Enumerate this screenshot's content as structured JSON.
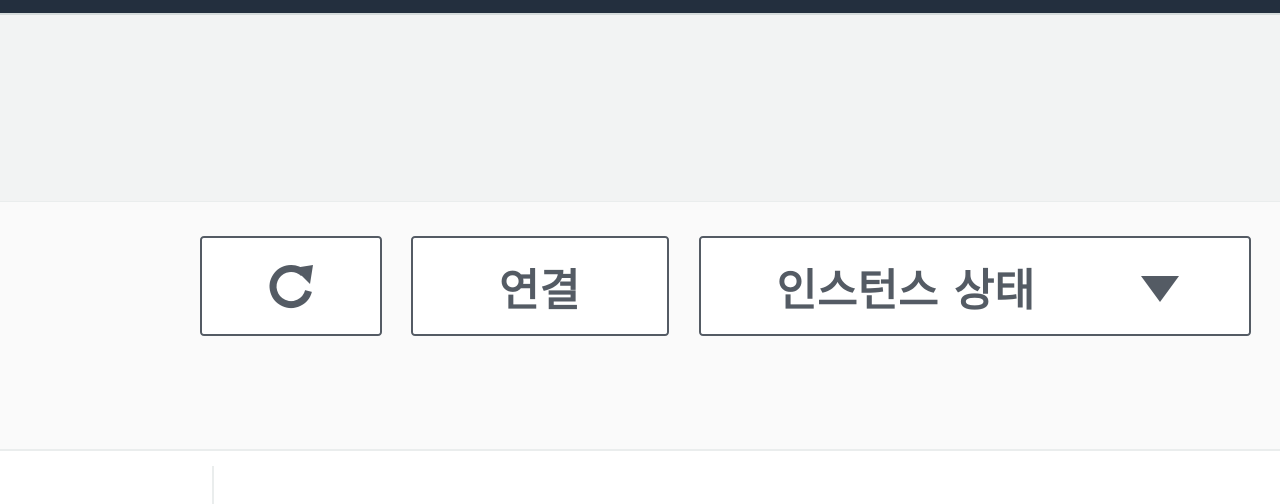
{
  "toolbar": {
    "refresh_icon": "refresh-icon",
    "connect_label": "연결",
    "instance_state_label": "인스턴스 상태",
    "instance_state_caret_icon": "caret-down-icon"
  },
  "colors": {
    "top_bar": "#232f3e",
    "header_band": "#f2f3f3",
    "toolbar_bg": "#fafafa",
    "button_border": "#545b64",
    "button_text": "#545b64"
  }
}
